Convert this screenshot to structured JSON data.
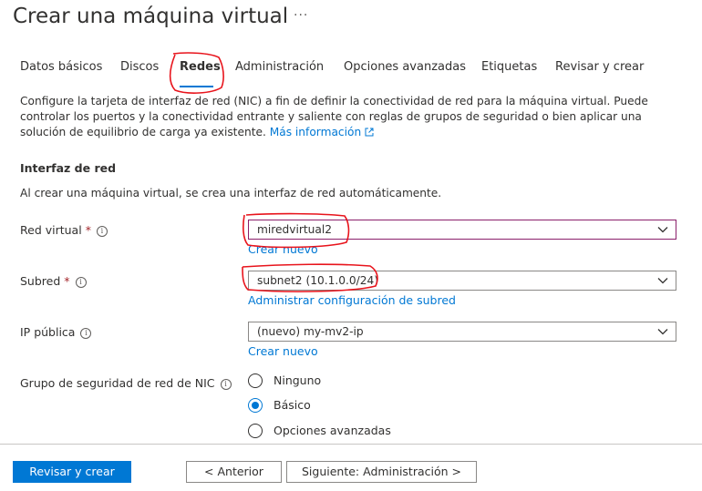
{
  "page": {
    "title": "Crear una máquina virtual",
    "more": "···"
  },
  "tabs": [
    {
      "label": "Datos básicos"
    },
    {
      "label": "Discos"
    },
    {
      "label": "Redes"
    },
    {
      "label": "Administración"
    },
    {
      "label": "Opciones avanzadas"
    },
    {
      "label": "Etiquetas"
    },
    {
      "label": "Revisar y crear"
    }
  ],
  "active_tab": "Redes",
  "description": {
    "text": "Configure la tarjeta de interfaz de red (NIC) a fin de definir la conectividad de red para la máquina virtual. Puede controlar los puertos y la conectividad entrante y saliente con reglas de grupos de seguridad o bien aplicar una solución de equilibrio de carga ya existente.",
    "link": "Más información"
  },
  "nic_section": {
    "heading": "Interfaz de red",
    "desc": "Al crear una máquina virtual, se crea una interfaz de red automáticamente."
  },
  "fields": {
    "vnet": {
      "label": "Red virtual",
      "required": "*",
      "value": "miredvirtual2",
      "link": "Crear nuevo"
    },
    "subnet": {
      "label": "Subred",
      "required": "*",
      "value": "subnet2 (10.1.0.0/24)",
      "link": "Administrar configuración de subred"
    },
    "public_ip": {
      "label": "IP pública",
      "value": "(nuevo) my-mv2-ip",
      "link": "Crear nuevo"
    },
    "nsg": {
      "label": "Grupo de seguridad de red de NIC",
      "options": [
        "Ninguno",
        "Básico",
        "Opciones avanzadas"
      ],
      "selected": "Básico"
    }
  },
  "footer": {
    "review_create": "Revisar y crear",
    "previous": "< Anterior",
    "next": "Siguiente: Administración >"
  },
  "colors": {
    "accent": "#0078d4",
    "annotation": "#e8141c",
    "required": "#a4262c"
  }
}
